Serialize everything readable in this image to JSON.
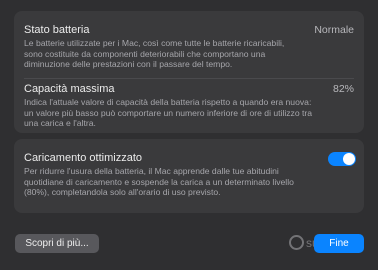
{
  "battery_state": {
    "title": "Stato batteria",
    "value": "Normale",
    "description": [
      "Le batterie utilizzate per i Mac, così come tutte le batterie ricaricabili,",
      "sono costituite da componenti deteriorabili che comportano una",
      "diminuzione delle prestazioni con il passare del tempo."
    ]
  },
  "max_capacity": {
    "title": "Capacità massima",
    "value": "82%",
    "description": [
      "Indica l'attuale valore di capacità della batteria rispetto a quando era nuova:",
      "un valore più basso può comportare un numero inferiore di ore di utilizzo tra",
      "una carica e l'altra."
    ]
  },
  "optimized_charging": {
    "title": "Caricamento ottimizzato",
    "enabled": true,
    "description": [
      "Per ridurre l'usura della batteria, il Mac apprende dalle tue abitudini",
      "quotidiane di caricamento e sospende la carica a un determinato livello",
      "(80%), completandola solo all'orario di uso previsto."
    ]
  },
  "footer": {
    "more_label": "Scopri di più...",
    "done_label": "Fine"
  },
  "watermark": {
    "text": "subito"
  },
  "colors": {
    "accent": "#0a84ff",
    "panel": "#3a3a3c",
    "background": "#2f2f31"
  }
}
